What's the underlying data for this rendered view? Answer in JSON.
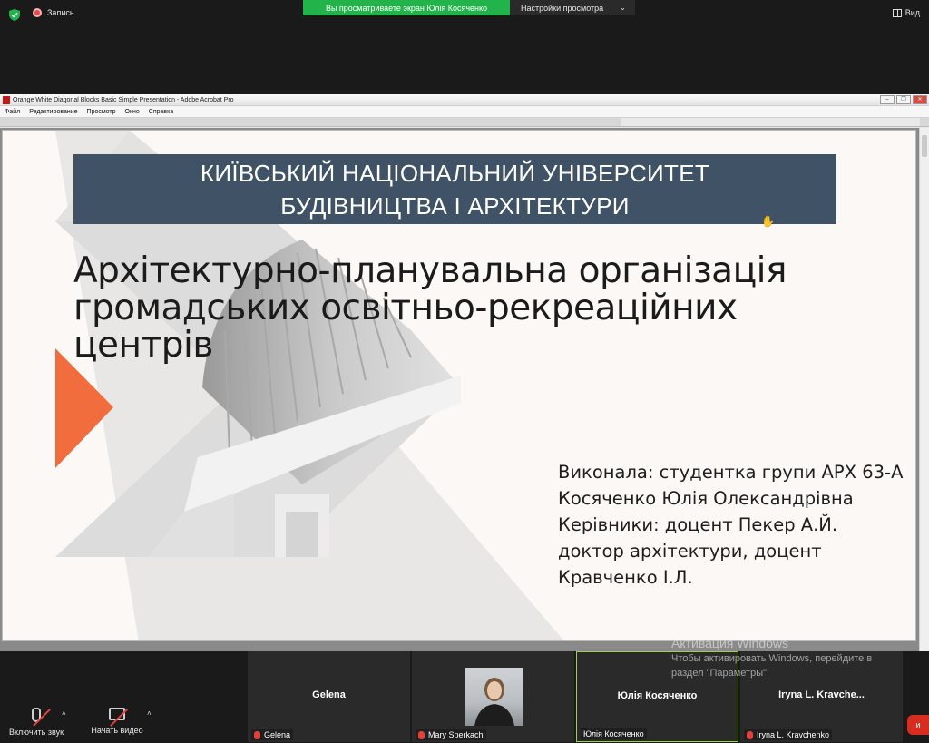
{
  "zoom": {
    "recording_label": "Запись",
    "share_banner": "Вы просматриваете экран Юлія Косяченко",
    "view_settings": "Настройки просмотра",
    "view_button": "Вид",
    "unmute_label": "Включить звук",
    "start_video_label": "Начать видео"
  },
  "acrobat": {
    "title": "Orange White Diagonal Blocks Basic Simple Presentation - Adobe Acrobat Pro",
    "menu": [
      "Файл",
      "Редактирование",
      "Просмотр",
      "Окно",
      "Справка"
    ]
  },
  "slide": {
    "university_line1": "КИЇВСЬКИЙ НАЦІОНАЛЬНИЙ УНІВЕРСИТЕТ",
    "university_line2": "БУДІВНИЦТВА І АРХІТЕКТУРИ",
    "title_lines": [
      "Архітектурно-планувальна організація",
      "громадських освітньо-рекреаційних",
      "центрів"
    ],
    "credits": [
      "Виконала: студентка групи АРХ 63-А",
      "Косяченко Юлія Олександрівна",
      "Керівники: доцент Пекер А.Й.",
      "доктор архітектури, доцент",
      "Кравченко І.Л."
    ],
    "colors": {
      "band": "#3f5266",
      "accent": "#f26d3d",
      "bg": "#fbf8f5"
    }
  },
  "windows_activation": {
    "title": "Активация Windows",
    "line1": "Чтобы активировать Windows, перейдите в",
    "line2": "раздел \"Параметры\"."
  },
  "participants": [
    {
      "center_name": "Gelena",
      "label": "Gelena"
    },
    {
      "center_name": "",
      "label": "Mary Sperkach"
    },
    {
      "center_name": "Юлія Косяченко",
      "label": "Юлія Косяченко"
    },
    {
      "center_name": "Iryna L. Kravche...",
      "label": "Iryna L. Kravchenko"
    }
  ]
}
